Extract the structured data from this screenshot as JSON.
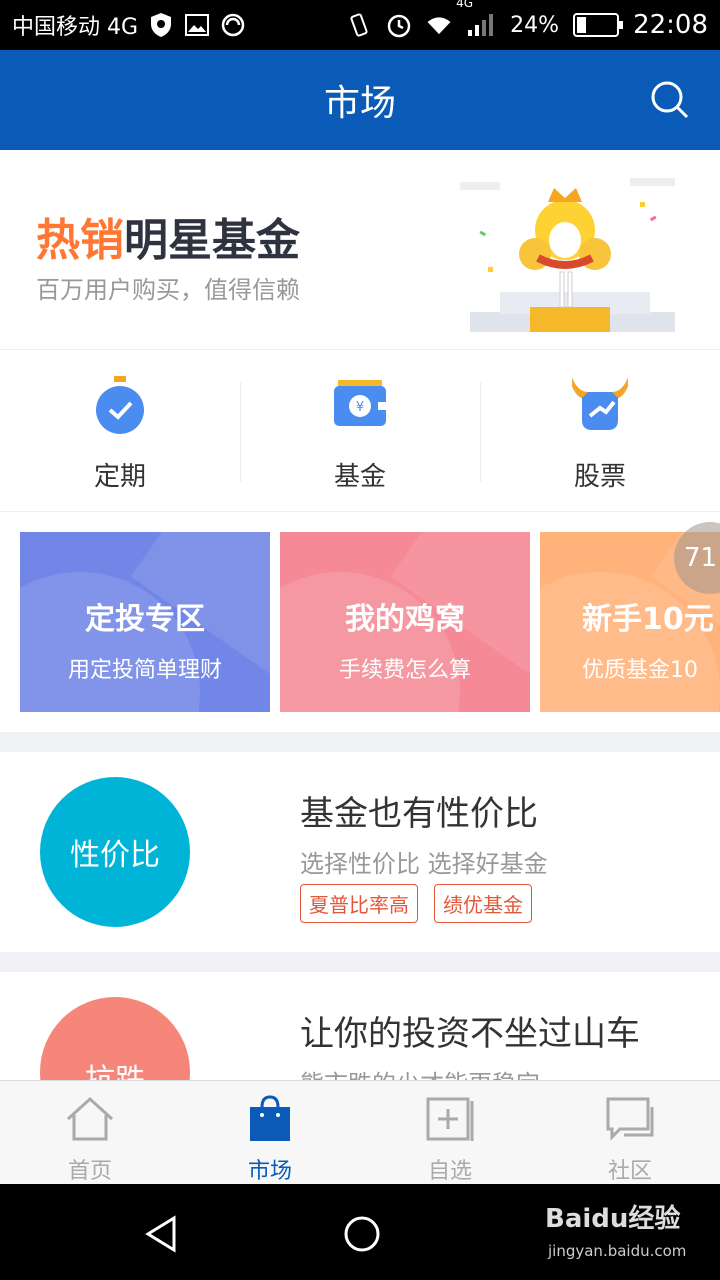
{
  "status_bar": {
    "carrier": "中国移动 4G",
    "network_small": "4G",
    "battery": "24%",
    "battery_level": 0.24,
    "time": "22:08"
  },
  "header": {
    "title": "市场"
  },
  "banner": {
    "headline_hot": "热销",
    "headline_rest": "明星基金",
    "subtitle": "百万用户购买，值得信赖"
  },
  "categories": [
    {
      "label": "定期",
      "icon": "stopwatch-icon"
    },
    {
      "label": "基金",
      "icon": "wallet-icon"
    },
    {
      "label": "股票",
      "icon": "bull-icon"
    }
  ],
  "promos": [
    {
      "title": "定投专区",
      "subtitle": "用定投简单理财",
      "color": "#7186e6"
    },
    {
      "title": "我的鸡窝",
      "subtitle": "手续费怎么算",
      "color": "#f58a96"
    },
    {
      "title": "新手10元",
      "subtitle": "优质基金10",
      "color": "#ffb27a"
    }
  ],
  "floating_badge": "71",
  "features": [
    {
      "circle_text": "性价比",
      "circle_color": "#00b4d8",
      "title": "基金也有性价比",
      "subtitle": "选择性价比 选择好基金",
      "tags": [
        "夏普比率高",
        "绩优基金"
      ]
    },
    {
      "circle_text": "抗跌",
      "circle_color": "#f6867a",
      "title": "让你的投资不坐过山车",
      "subtitle": "熊市跌的少才能更稳定"
    }
  ],
  "bottom_nav": [
    {
      "label": "首页",
      "icon": "home-icon",
      "active": false
    },
    {
      "label": "市场",
      "icon": "shopping-bag-icon",
      "active": true
    },
    {
      "label": "自选",
      "icon": "add-watchlist-icon",
      "active": false
    },
    {
      "label": "社区",
      "icon": "chat-icon",
      "active": false
    }
  ],
  "watermark": {
    "brand": "Baidu经验",
    "url": "jingyan.baidu.com"
  },
  "colors": {
    "primary": "#0a5bb8",
    "hot": "#ff7733",
    "tag": "#e2583a"
  }
}
